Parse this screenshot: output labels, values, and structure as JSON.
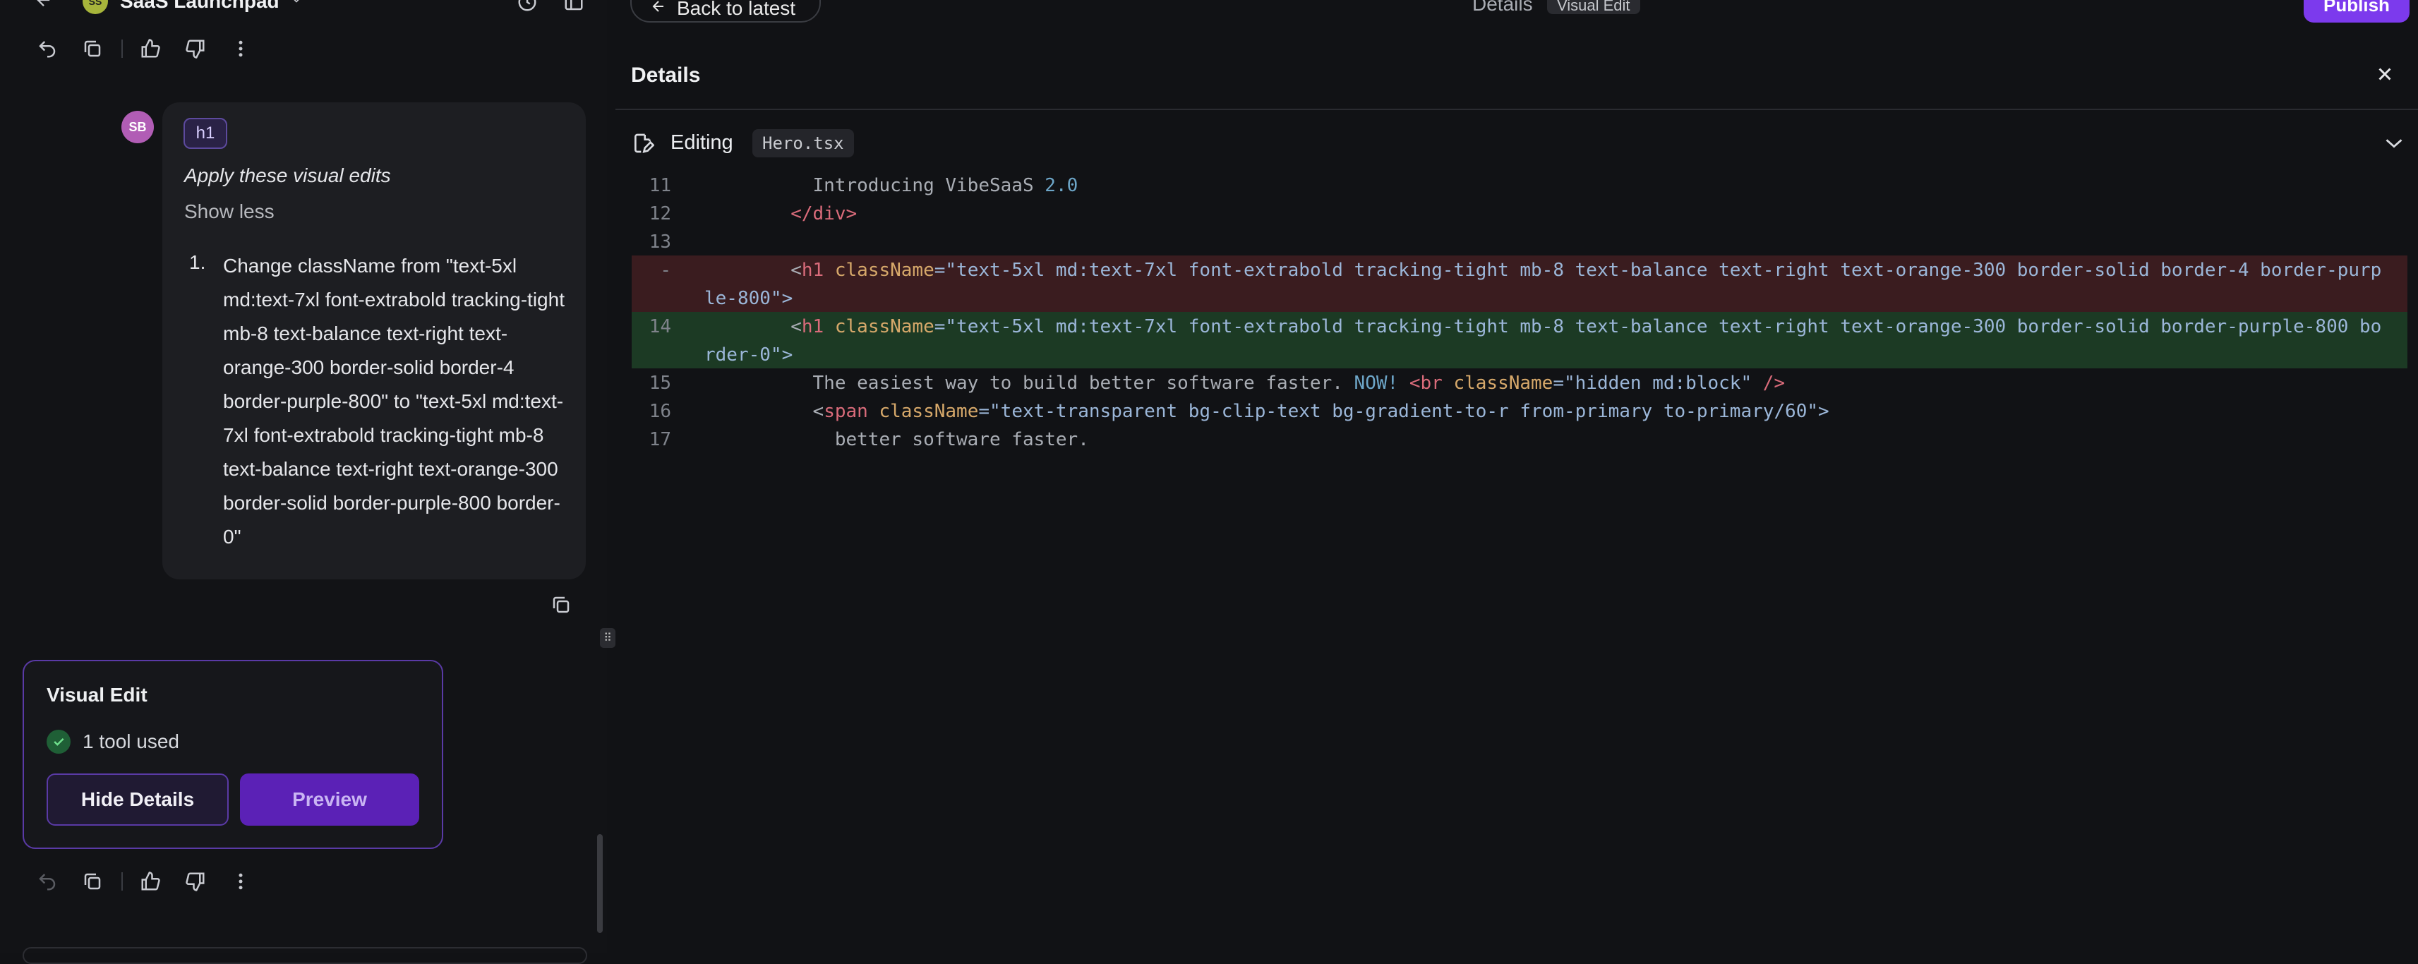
{
  "header": {
    "project_initials": "SS",
    "project_name": "SaaS Launchpad",
    "back_label": "Back to latest",
    "center_title": "Details",
    "center_badge": "Visual Edit",
    "publish_label": "Publish"
  },
  "chat": {
    "user_initials": "SB",
    "tag": "h1",
    "message_title": "Apply these visual edits",
    "toggle_label": "Show less",
    "list_number": "1.",
    "list_text": "Change className from \"text-5xl md:text-7xl font-extrabold tracking-tight mb-8 text-balance text-right text-orange-300 border-solid border-4 border-purple-800\" to \"text-5xl md:text-7xl font-extrabold tracking-tight mb-8 text-balance text-right text-orange-300 border-solid border-purple-800 border-0\""
  },
  "visual_edit_card": {
    "title": "Visual Edit",
    "tools_used": "1 tool used",
    "hide_label": "Hide Details",
    "preview_label": "Preview"
  },
  "details": {
    "title": "Details",
    "editing_label": "Editing",
    "file_name": "Hero.tsx",
    "lines": [
      {
        "num": "11",
        "kind": "context",
        "segments": [
          {
            "t": "          Introducing VibeSaaS ",
            "c": "text"
          },
          {
            "t": "2.0",
            "c": "num"
          }
        ]
      },
      {
        "num": "12",
        "kind": "context",
        "segments": [
          {
            "t": "        </div>",
            "c": "tag"
          }
        ]
      },
      {
        "num": "13",
        "kind": "context",
        "segments": []
      },
      {
        "num": "-",
        "kind": "removed",
        "segments": [
          {
            "t": "        <",
            "c": "text"
          },
          {
            "t": "h1",
            "c": "tag"
          },
          {
            "t": " className",
            "c": "attr"
          },
          {
            "t": "=\"text-5xl md:text-7xl font-extrabold tracking-tight mb-8 text-balance text-right text-orange-300 border-solid border-4 border-purp",
            "c": "str"
          }
        ],
        "wrap": "le-800\">"
      },
      {
        "num": "14",
        "kind": "added",
        "segments": [
          {
            "t": "        <",
            "c": "text"
          },
          {
            "t": "h1",
            "c": "tag"
          },
          {
            "t": " className",
            "c": "attr"
          },
          {
            "t": "=\"text-5xl md:text-7xl font-extrabold tracking-tight mb-8 text-balance text-right text-orange-300 border-solid border-purple-800 bo",
            "c": "str"
          }
        ],
        "wrap": "rder-0\">"
      },
      {
        "num": "15",
        "kind": "context",
        "segments": [
          {
            "t": "          The easiest way to build better software faster. ",
            "c": "text"
          },
          {
            "t": "NOW!",
            "c": "num"
          },
          {
            "t": " <br ",
            "c": "tag"
          },
          {
            "t": "className",
            "c": "attr"
          },
          {
            "t": "=\"hidden md:block\"",
            "c": "str"
          },
          {
            "t": " />",
            "c": "tag"
          }
        ]
      },
      {
        "num": "16",
        "kind": "context",
        "segments": [
          {
            "t": "          <",
            "c": "text"
          },
          {
            "t": "span ",
            "c": "tag"
          },
          {
            "t": "className",
            "c": "attr"
          },
          {
            "t": "=\"text-transparent bg-clip-text bg-gradient-to-r from-primary to-primary/60\">",
            "c": "str"
          }
        ]
      },
      {
        "num": "17",
        "kind": "context",
        "segments": [
          {
            "t": "            better software faster.",
            "c": "text"
          }
        ]
      }
    ]
  },
  "colors": {
    "accent": "#7c3aed",
    "removed_bg": "#3a1c1f",
    "added_bg": "#1c3a24"
  },
  "icons": [
    "back-arrow-icon",
    "chevron-down-icon",
    "history-icon",
    "sidebar-icon",
    "undo-icon",
    "copy-icon",
    "thumbs-up-icon",
    "thumbs-down-icon",
    "more-icon",
    "check-icon",
    "file-edit-icon",
    "close-icon",
    "grip-icon"
  ]
}
